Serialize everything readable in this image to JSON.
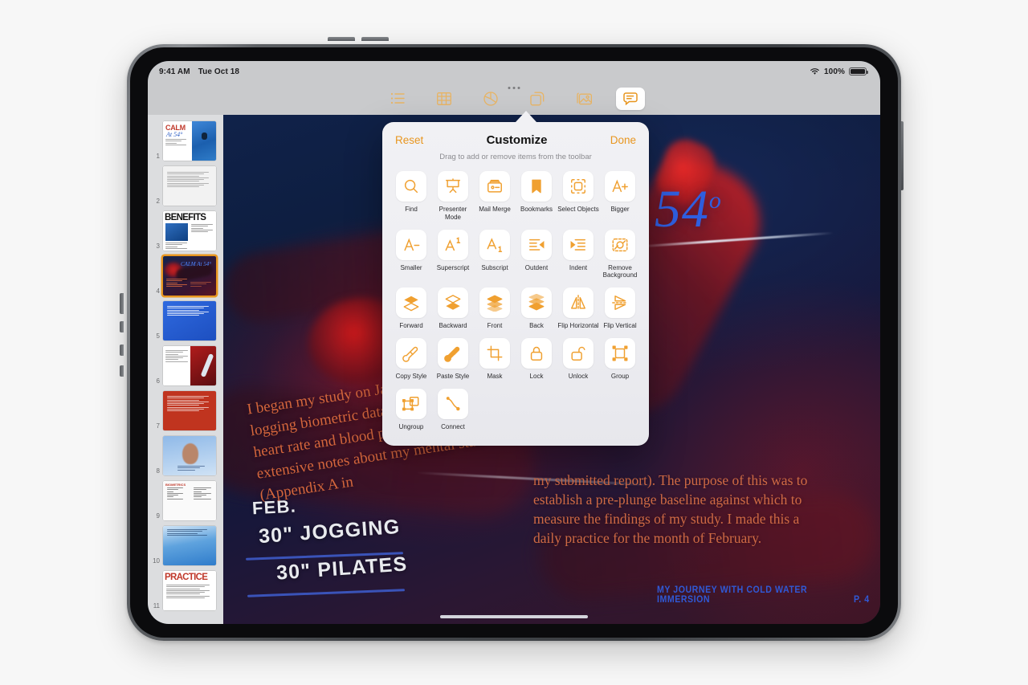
{
  "statusbar": {
    "time": "9:41 AM",
    "date": "Tue Oct 18",
    "battery_percent": "100%",
    "wifi_icon": "wifi-icon",
    "battery_icon": "battery-icon"
  },
  "toolbar": {
    "items": [
      {
        "name": "list-icon",
        "label": "List"
      },
      {
        "name": "table-icon",
        "label": "Table"
      },
      {
        "name": "chart-icon",
        "label": "Chart"
      },
      {
        "name": "shape-icon",
        "label": "Shape"
      },
      {
        "name": "media-icon",
        "label": "Media"
      },
      {
        "name": "comment-icon",
        "label": "Comment"
      }
    ],
    "active_index": 5,
    "drag_handle": "drag-handle"
  },
  "popover": {
    "reset_label": "Reset",
    "title": "Customize",
    "done_label": "Done",
    "subtitle": "Drag to add or remove items from the toolbar",
    "accent_color": "#e8961f",
    "items": [
      {
        "label": "Find",
        "icon": "search-icon"
      },
      {
        "label": "Presenter\nMode",
        "icon": "presenter-mode-icon"
      },
      {
        "label": "Mail Merge",
        "icon": "mail-merge-icon"
      },
      {
        "label": "Bookmarks",
        "icon": "bookmark-icon"
      },
      {
        "label": "Select Objects",
        "icon": "select-objects-icon"
      },
      {
        "label": "Bigger",
        "icon": "font-bigger-icon"
      },
      {
        "label": "Smaller",
        "icon": "font-smaller-icon"
      },
      {
        "label": "Superscript",
        "icon": "superscript-icon"
      },
      {
        "label": "Subscript",
        "icon": "subscript-icon"
      },
      {
        "label": "Outdent",
        "icon": "outdent-icon"
      },
      {
        "label": "Indent",
        "icon": "indent-icon"
      },
      {
        "label": "Remove\nBackground",
        "icon": "remove-background-icon"
      },
      {
        "label": "Forward",
        "icon": "forward-icon"
      },
      {
        "label": "Backward",
        "icon": "backward-icon"
      },
      {
        "label": "Front",
        "icon": "bring-front-icon"
      },
      {
        "label": "Back",
        "icon": "send-back-icon"
      },
      {
        "label": "Flip Horizontal",
        "icon": "flip-horizontal-icon"
      },
      {
        "label": "Flip Vertical",
        "icon": "flip-vertical-icon"
      },
      {
        "label": "Copy Style",
        "icon": "copy-style-icon"
      },
      {
        "label": "Paste Style",
        "icon": "paste-style-icon"
      },
      {
        "label": "Mask",
        "icon": "mask-icon"
      },
      {
        "label": "Lock",
        "icon": "lock-icon"
      },
      {
        "label": "Unlock",
        "icon": "unlock-icon"
      },
      {
        "label": "Group",
        "icon": "group-icon"
      },
      {
        "label": "Ungroup",
        "icon": "ungroup-icon"
      },
      {
        "label": "Connect",
        "icon": "connect-icon"
      }
    ]
  },
  "sidebar": {
    "pages": [
      {
        "number": "1",
        "kind": "calm",
        "title": "CALM",
        "subtitle": "At 54°"
      },
      {
        "number": "2",
        "kind": "text",
        "title": "",
        "subtitle": ""
      },
      {
        "number": "3",
        "kind": "benefits",
        "title": "BENEFITS",
        "subtitle": ""
      },
      {
        "number": "4",
        "kind": "dark",
        "title": "",
        "subtitle": "",
        "selected": true
      },
      {
        "number": "5",
        "kind": "blue",
        "title": "",
        "subtitle": ""
      },
      {
        "number": "6",
        "kind": "thermo",
        "title": "",
        "subtitle": ""
      },
      {
        "number": "7",
        "kind": "red",
        "title": "",
        "subtitle": ""
      },
      {
        "number": "8",
        "kind": "portrait",
        "title": "",
        "subtitle": ""
      },
      {
        "number": "9",
        "kind": "notes",
        "title": "",
        "subtitle": ""
      },
      {
        "number": "10",
        "kind": "water",
        "title": "",
        "subtitle": ""
      },
      {
        "number": "11",
        "kind": "practice",
        "title": "PRACTICE",
        "subtitle": ""
      }
    ]
  },
  "document": {
    "headline": "t 54",
    "headline_degree": "o",
    "rotated_paragraph": "I began my study on January 31, 2022, by logging biometric data such as resting heart rate and blood pressure, and taking extensive notes about my mental state (Appendix A in",
    "right_paragraph": "my submitted report). The purpose of this was to establish a pre-plunge baseline against which to measure the findings of my study. I made this a daily practice for the month of February.",
    "handwriting_line1": "FEB.",
    "handwriting_line2": "30\" JOGGING",
    "handwriting_line3": "30\" PILATES",
    "footer_title": "MY JOURNEY WITH COLD WATER IMMERSION",
    "footer_page": "P. 4"
  }
}
